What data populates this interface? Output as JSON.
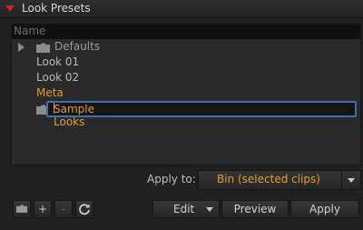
{
  "panel": {
    "title": "Look Presets"
  },
  "list": {
    "column_header": "Name",
    "items": [
      {
        "label": "Defaults",
        "type": "folder",
        "expander": "play-icon"
      },
      {
        "label": "Look 01",
        "type": "preset"
      },
      {
        "label": "Look 02",
        "type": "preset"
      },
      {
        "label": "Meta",
        "type": "preset",
        "highlighted": true
      },
      {
        "label": "Sample Looks",
        "type": "folder",
        "editing": true
      }
    ]
  },
  "apply_to": {
    "label": "Apply to:",
    "value": "Bin (selected clips)"
  },
  "toolbar": {
    "new_folder_icon": "folder-icon",
    "add_label": "+",
    "remove_label": "-",
    "refresh_icon": "refresh-icon",
    "edit_label": "Edit",
    "preview_label": "Preview",
    "apply_label": "Apply"
  },
  "colors": {
    "accent": "#e49a2a",
    "selection_border": "#3a6fb0",
    "collapse_arrow": "#d22424"
  }
}
